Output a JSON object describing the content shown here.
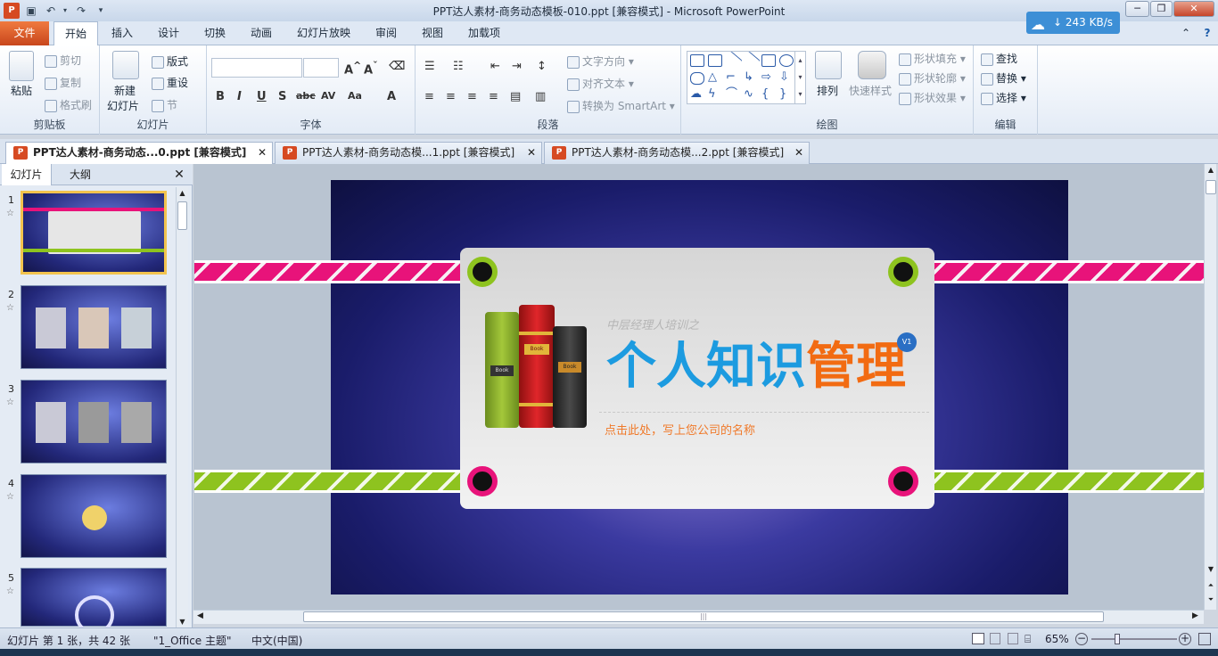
{
  "window": {
    "title": "PPT达人素材-商务动态模板-010.ppt [兼容模式] - Microsoft PowerPoint",
    "network_speed": "243 KB/s"
  },
  "ribbon_tabs": [
    "文件",
    "开始",
    "插入",
    "设计",
    "切换",
    "动画",
    "幻灯片放映",
    "审阅",
    "视图",
    "加载项"
  ],
  "ribbon": {
    "clipboard": {
      "label": "剪贴板",
      "paste": "粘贴",
      "cut": "剪切",
      "copy": "复制",
      "format_painter": "格式刷"
    },
    "slides": {
      "label": "幻灯片",
      "new_slide_1": "新建",
      "new_slide_2": "幻灯片",
      "layout": "版式",
      "reset": "重设",
      "section": "节"
    },
    "font": {
      "label": "字体"
    },
    "paragraph": {
      "label": "段落",
      "text_direction": "文字方向",
      "align_text": "对齐文本",
      "smartart": "转换为 SmartArt"
    },
    "drawing": {
      "label": "绘图",
      "arrange": "排列",
      "quick_styles": "快速样式",
      "shape_fill": "形状填充",
      "shape_outline": "形状轮廓",
      "shape_effects": "形状效果"
    },
    "editing": {
      "label": "编辑",
      "find": "查找",
      "replace": "替换",
      "select": "选择"
    }
  },
  "doc_tabs": [
    {
      "label": "PPT达人素材-商务动态...0.ppt [兼容模式]"
    },
    {
      "label": "PPT达人素材-商务动态模...1.ppt [兼容模式]"
    },
    {
      "label": "PPT达人素材-商务动态模...2.ppt [兼容模式]"
    }
  ],
  "left_pane": {
    "tab_slides": "幻灯片",
    "tab_outline": "大纲",
    "slide_numbers": [
      "1",
      "2",
      "3",
      "4",
      "5"
    ]
  },
  "slide": {
    "subtitle_small": "中层经理人培训之",
    "title_part1": "个人知识",
    "title_part2": "管理",
    "version_badge": "V1",
    "company_placeholder": "点击此处，写上您公司的名称",
    "book_label": "Book"
  },
  "status": {
    "slide_info": "幻灯片 第 1 张，共 42 张",
    "theme": "\"1_Office 主题\"",
    "language": "中文(中国)",
    "zoom": "65%"
  }
}
